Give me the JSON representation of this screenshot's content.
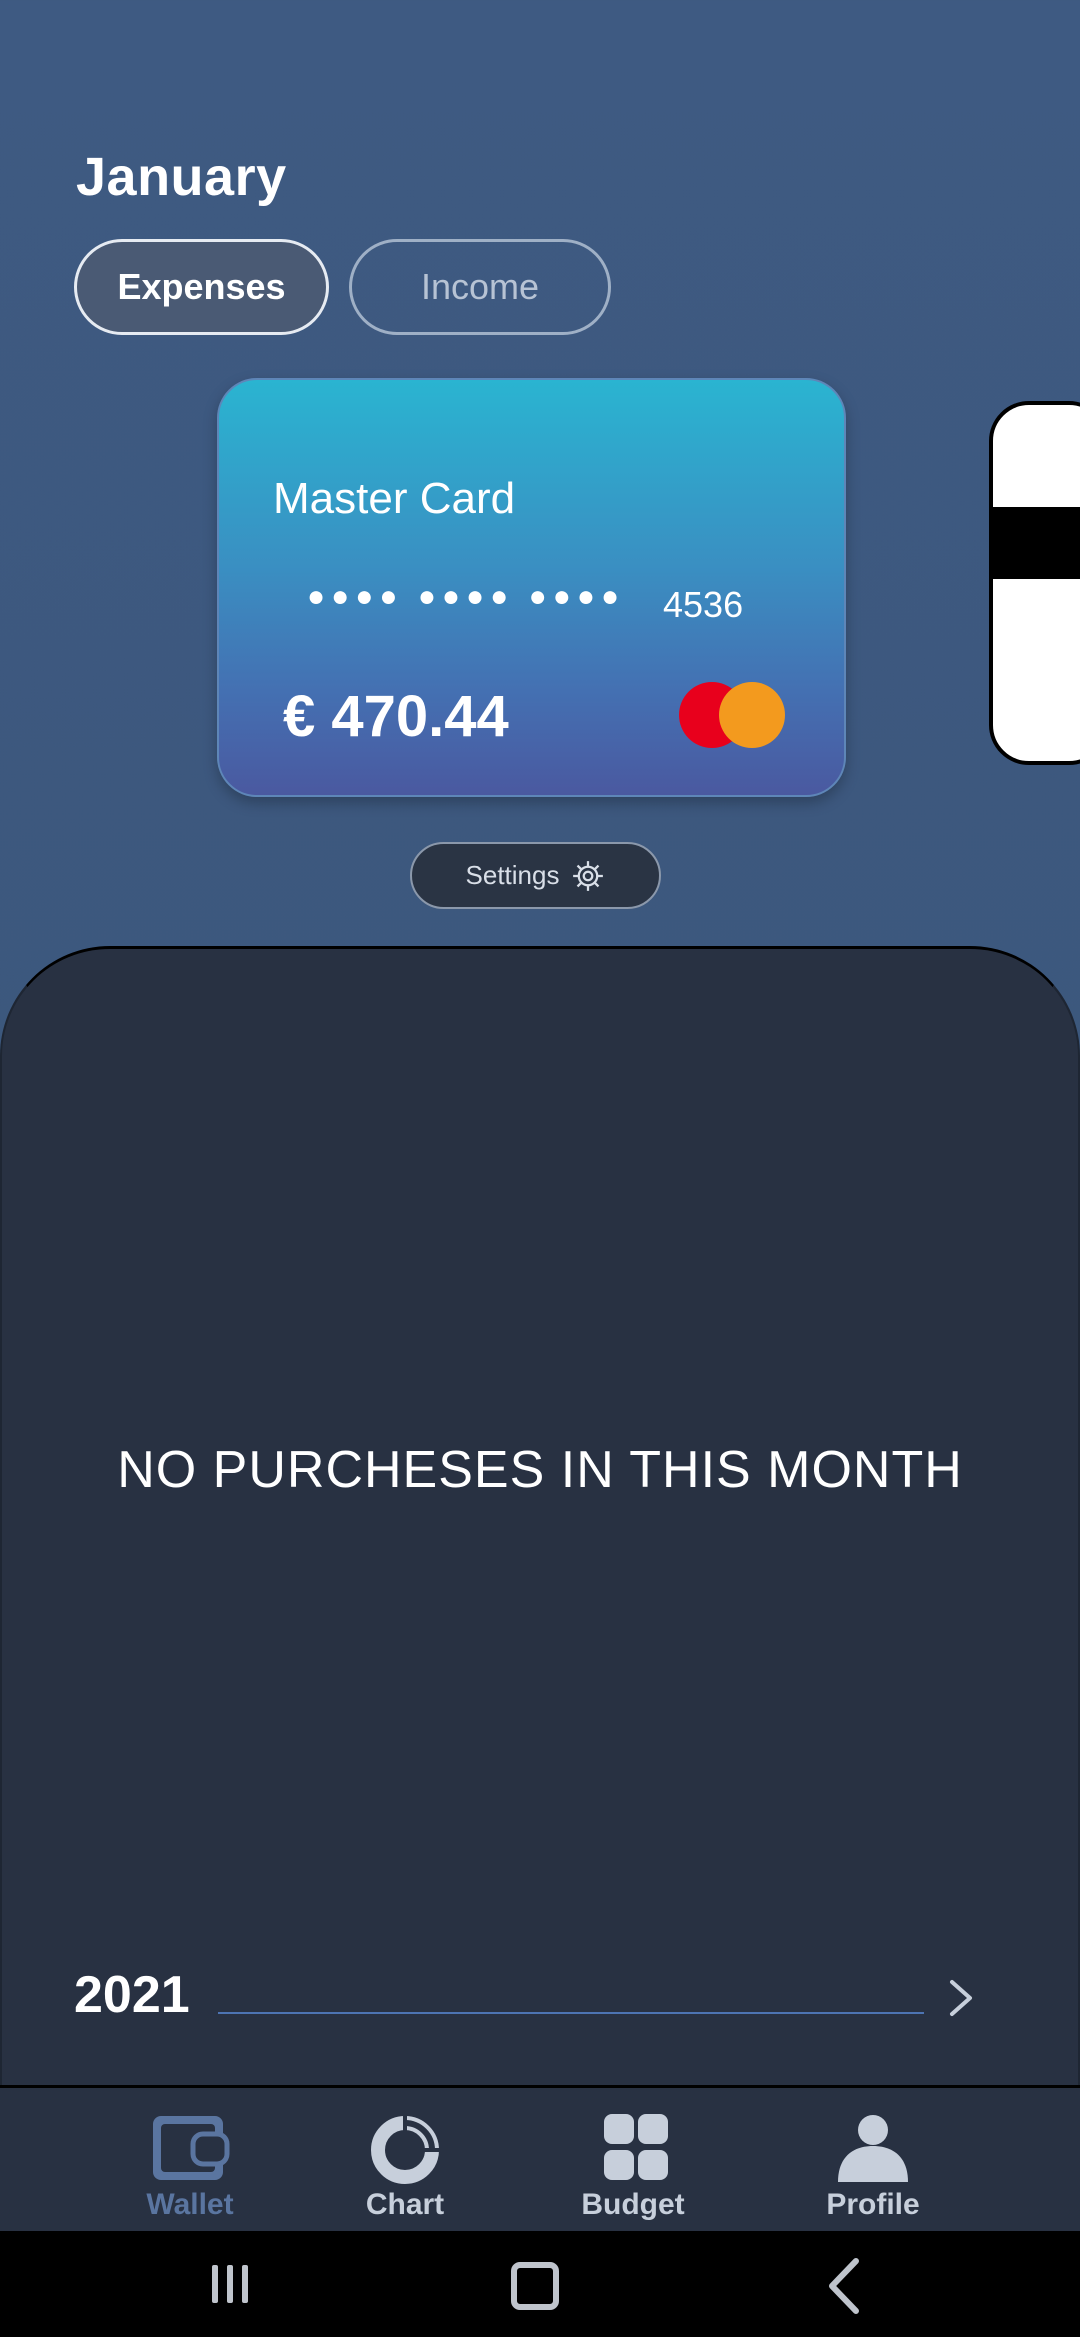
{
  "header": {
    "month": "January",
    "tabs": [
      {
        "label": "Expenses",
        "selected": true
      },
      {
        "label": "Income",
        "selected": false
      }
    ]
  },
  "card": {
    "name": "Master Card",
    "masked_number": "●●●● ●●●● ●●●●",
    "last4": "4536",
    "balance": "€ 470.44",
    "brand_icon": "mastercard-logo-icon"
  },
  "settings": {
    "label": "Settings",
    "icon": "gear-icon"
  },
  "transactions": {
    "empty_message": "NO PURCHESES IN THIS MONTH"
  },
  "year_nav": {
    "year": "2021",
    "icon": "chevron-right-icon"
  },
  "bottom_nav": {
    "items": [
      {
        "label": "Wallet",
        "icon": "wallet-icon",
        "active": true
      },
      {
        "label": "Chart",
        "icon": "donut-chart-icon",
        "active": false
      },
      {
        "label": "Budget",
        "icon": "grid-icon",
        "active": false
      },
      {
        "label": "Profile",
        "icon": "person-icon",
        "active": false
      }
    ]
  },
  "system_nav": {
    "buttons": [
      "recents-icon",
      "home-icon",
      "back-icon"
    ]
  },
  "colors": {
    "background": "#3e5a82",
    "panel": "#283142",
    "card_top": "#2ab4d1",
    "card_bottom": "#4a59a0",
    "active_nav": "#5a75a0",
    "mc_red": "#e8001c",
    "mc_orange": "#f39a1e"
  }
}
